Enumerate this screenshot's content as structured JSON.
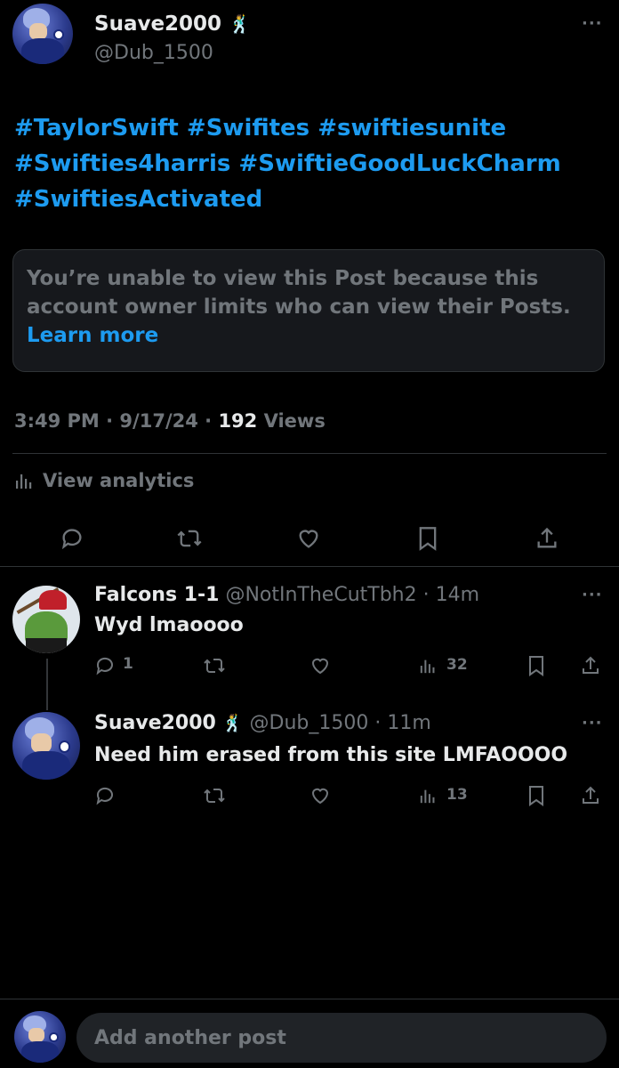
{
  "main_post": {
    "author_name": "Suave2000",
    "author_emoji": "🕺",
    "author_handle": "@Dub_1500",
    "hashtags_line1": "#TaylorSwift #Swifites #swiftiesunite",
    "hashtags_line2": "#Swifties4harris #SwiftieGoodLuckCharm",
    "hashtags_line3": "#SwiftiesActivated",
    "notice_text": "You’re unable to view this Post because this account owner limits who can view their Posts.",
    "notice_link": "Learn more",
    "time": "3:49 PM · 9/17/24 · ",
    "views_count": "192",
    "views_label": " Views",
    "analytics_label": "View analytics"
  },
  "replies": [
    {
      "author_name": "Falcons 1-1",
      "author_handle": "@NotInTheCutTbh2",
      "time": "· 14m",
      "text": "Wyd lmaoooo",
      "reply_count": "1",
      "views": "32"
    },
    {
      "author_name": "Suave2000",
      "author_emoji": "🕺",
      "author_handle": "@Dub_1500",
      "time": "· 11m",
      "text": "Need him erased from this site LMFAOOOO",
      "reply_count": "",
      "views": "13"
    }
  ],
  "composer": {
    "placeholder": "Add another post"
  },
  "icons": [
    "more-icon",
    "reply-icon",
    "retweet-icon",
    "like-icon",
    "bookmark-icon",
    "share-icon",
    "analytics-icon"
  ],
  "colors": {
    "background": "#000000",
    "text": "#e7e9ea",
    "muted": "#71767b",
    "accent": "#1d9bf0",
    "divider": "#2f3336"
  }
}
